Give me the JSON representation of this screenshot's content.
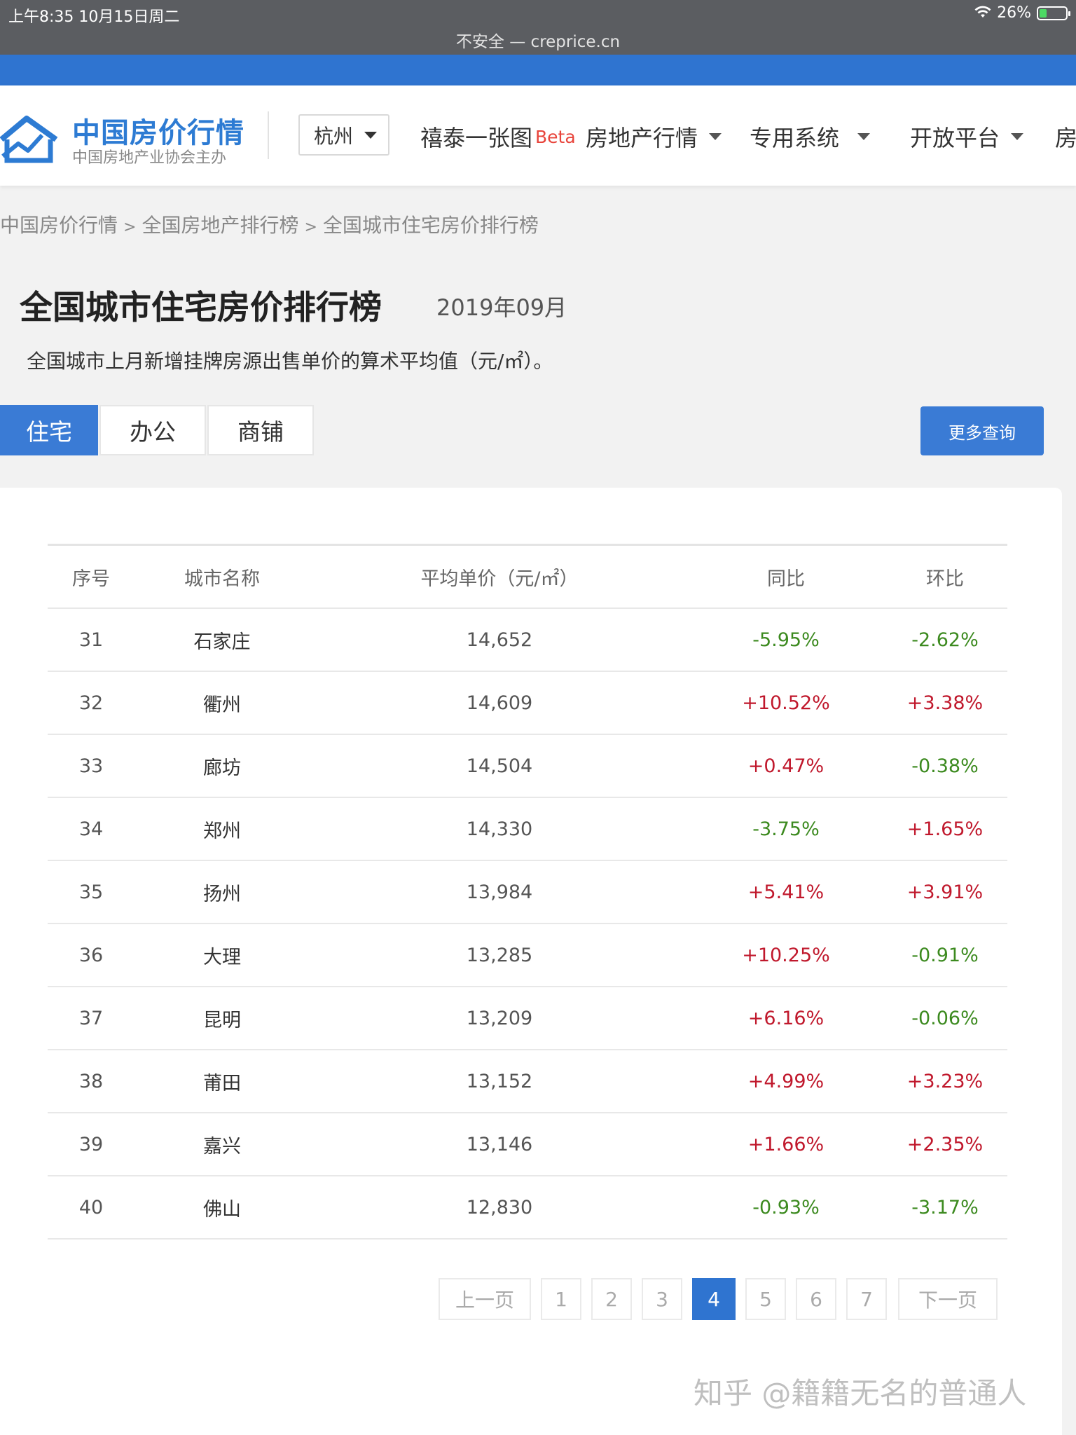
{
  "status_bar": {
    "time": "上午8:35   10月15日周二",
    "battery": "26%",
    "address": "不安全 — creprice.cn"
  },
  "header": {
    "logo_title": "中国房价行情",
    "logo_subtitle": "中国房地产业协会主办",
    "city": "杭州",
    "nav": {
      "xitai": "禧泰一张图",
      "beta": "Beta",
      "market": "房地产行情",
      "system": "专用系统",
      "open": "开放平台",
      "cut": "房"
    }
  },
  "breadcrumb": {
    "home": "中国房价行情",
    "sep": ">",
    "rank": "全国房地产排行榜",
    "current": "全国城市住宅房价排行榜"
  },
  "page": {
    "title": "全国城市住宅房价排行榜",
    "date": "2019年09月",
    "description": "全国城市上月新增挂牌房源出售单价的算术平均值（元/㎡）。"
  },
  "tabs": [
    {
      "label": "住宅",
      "active": true
    },
    {
      "label": "办公",
      "active": false
    },
    {
      "label": "商铺",
      "active": false
    }
  ],
  "more_button": "更多查询",
  "table": {
    "columns": [
      "序号",
      "城市名称",
      "平均单价（元/㎡）",
      "同比",
      "环比"
    ],
    "rows": [
      [
        "31",
        "石家庄",
        "14,652",
        "-5.95%",
        "-2.62%"
      ],
      [
        "32",
        "衢州",
        "14,609",
        "+10.52%",
        "+3.38%"
      ],
      [
        "33",
        "廊坊",
        "14,504",
        "+0.47%",
        "-0.38%"
      ],
      [
        "34",
        "郑州",
        "14,330",
        "-3.75%",
        "+1.65%"
      ],
      [
        "35",
        "扬州",
        "13,984",
        "+5.41%",
        "+3.91%"
      ],
      [
        "36",
        "大理",
        "13,285",
        "+10.25%",
        "-0.91%"
      ],
      [
        "37",
        "昆明",
        "13,209",
        "+6.16%",
        "-0.06%"
      ],
      [
        "38",
        "莆田",
        "13,152",
        "+4.99%",
        "+3.23%"
      ],
      [
        "39",
        "嘉兴",
        "13,146",
        "+1.66%",
        "+2.35%"
      ],
      [
        "40",
        "佛山",
        "12,830",
        "-0.93%",
        "-3.17%"
      ]
    ]
  },
  "pagination": {
    "prev": "上一页",
    "pages": [
      "1",
      "2",
      "3",
      "4",
      "5",
      "6",
      "7"
    ],
    "current": "4",
    "next": "下一页"
  },
  "watermark": "知乎 @籍籍无名的普通人",
  "colors": {
    "brand_blue": "#2f74d0",
    "positive": "#c0182c",
    "negative": "#3c8a1f"
  }
}
